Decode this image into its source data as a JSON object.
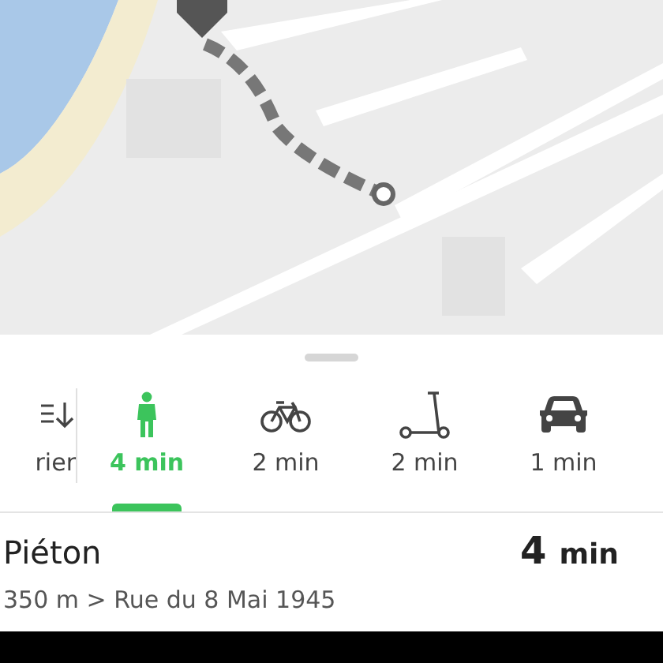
{
  "modes": [
    {
      "kind": "sort",
      "label": "rier",
      "selected": false
    },
    {
      "kind": "walk",
      "label": "4 min",
      "selected": true
    },
    {
      "kind": "bike",
      "label": "2 min",
      "selected": false
    },
    {
      "kind": "scooter",
      "label": "2 min",
      "selected": false
    },
    {
      "kind": "car",
      "label": "1 min",
      "selected": false
    }
  ],
  "summary": {
    "title": "Piéton",
    "duration_value": "4",
    "duration_unit": "min",
    "detail": "350 m > Rue du 8 Mai 1945"
  }
}
